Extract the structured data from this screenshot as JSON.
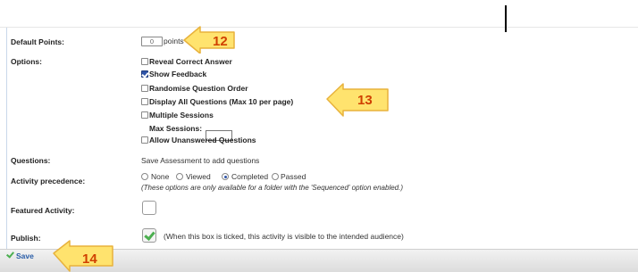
{
  "form": {
    "default_points_label": "Default Points:",
    "default_points_value": "0",
    "points_suffix": "points",
    "options_label": "Options:",
    "options": [
      {
        "label": "Reveal Correct Answer",
        "checked": false
      },
      {
        "label": "Show Feedback",
        "checked": true
      },
      {
        "label": "Randomise Question Order",
        "checked": false
      },
      {
        "label": "Display All Questions (Max 10 per page)",
        "checked": false
      },
      {
        "label": "Multiple Sessions",
        "checked": false
      }
    ],
    "max_sessions_label": "Max Sessions:",
    "max_sessions_value": "",
    "allow_unanswered": {
      "label": "Allow Unanswered Questions",
      "checked": false
    },
    "questions_label": "Questions:",
    "questions_text": "Save Assessment to add questions",
    "activity_precedence_label": "Activity precedence:",
    "precedence_options": [
      {
        "label": "None",
        "selected": false
      },
      {
        "label": "Viewed",
        "selected": false
      },
      {
        "label": "Completed",
        "selected": true
      },
      {
        "label": "Passed",
        "selected": false
      }
    ],
    "precedence_note": "(These options are only available for a folder with the 'Sequenced' option enabled.)",
    "featured_activity_label": "Featured Activity:",
    "featured_checked": false,
    "publish_label": "Publish:",
    "publish_checked": true,
    "publish_note": "(When this box is ticked, this activity is visible to the intended audience)"
  },
  "toolbar": {
    "save_label": "Save"
  },
  "callouts": [
    {
      "number": "12"
    },
    {
      "number": "13"
    },
    {
      "number": "14"
    }
  ],
  "colors": {
    "callout_fill": "#ffe36e",
    "callout_stroke": "#e8b23c",
    "callout_text": "#d04000",
    "accent": "#2f54a8"
  }
}
